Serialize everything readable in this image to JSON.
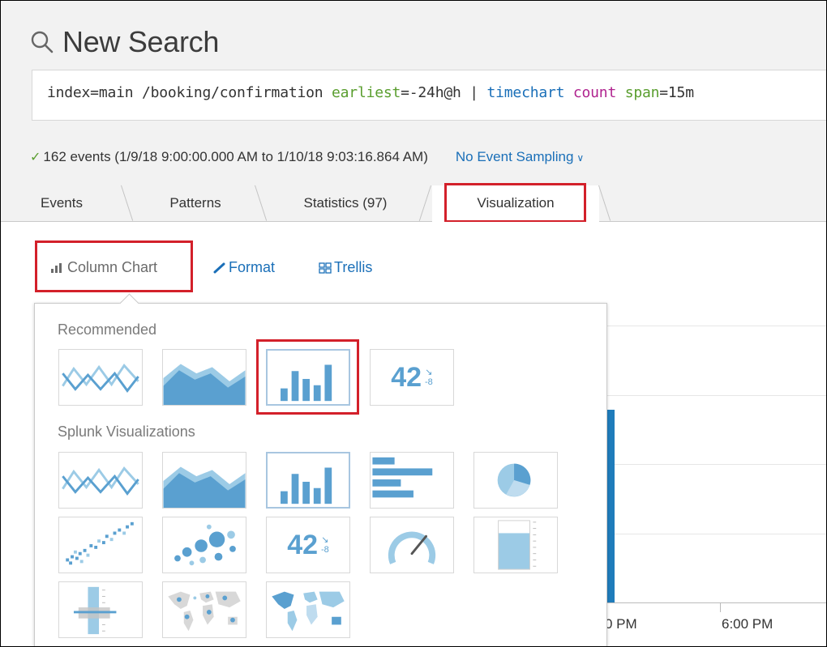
{
  "header": {
    "title": "New Search",
    "query": {
      "p1": "index=main /booking/confirmation ",
      "p2": "earliest",
      "p3": "=-24h@h | ",
      "p4": "timechart",
      "p5": " ",
      "p6": "count",
      "p7": " ",
      "p8": "span",
      "p9": "=15m"
    },
    "status": "162 events (1/9/18 9:00:00.000 AM to 1/10/18 9:03:16.864 AM)",
    "sampling": "No Event Sampling"
  },
  "tabs": [
    "Events",
    "Patterns",
    "Statistics (97)",
    "Visualization"
  ],
  "toolbar": {
    "chart_type": "Column Chart",
    "format": "Format",
    "trellis": "Trellis"
  },
  "picker": {
    "recommended_label": "Recommended",
    "splunk_label": "Splunk Visualizations",
    "single_value": "42",
    "single_value_delta": "-8"
  },
  "background_chart": {
    "x_labels": [
      "0 PM",
      "6:00 PM"
    ]
  },
  "colors": {
    "accent": "#1a6fb8",
    "highlight": "#d3202a",
    "viz_blue": "#5aa0d0"
  }
}
